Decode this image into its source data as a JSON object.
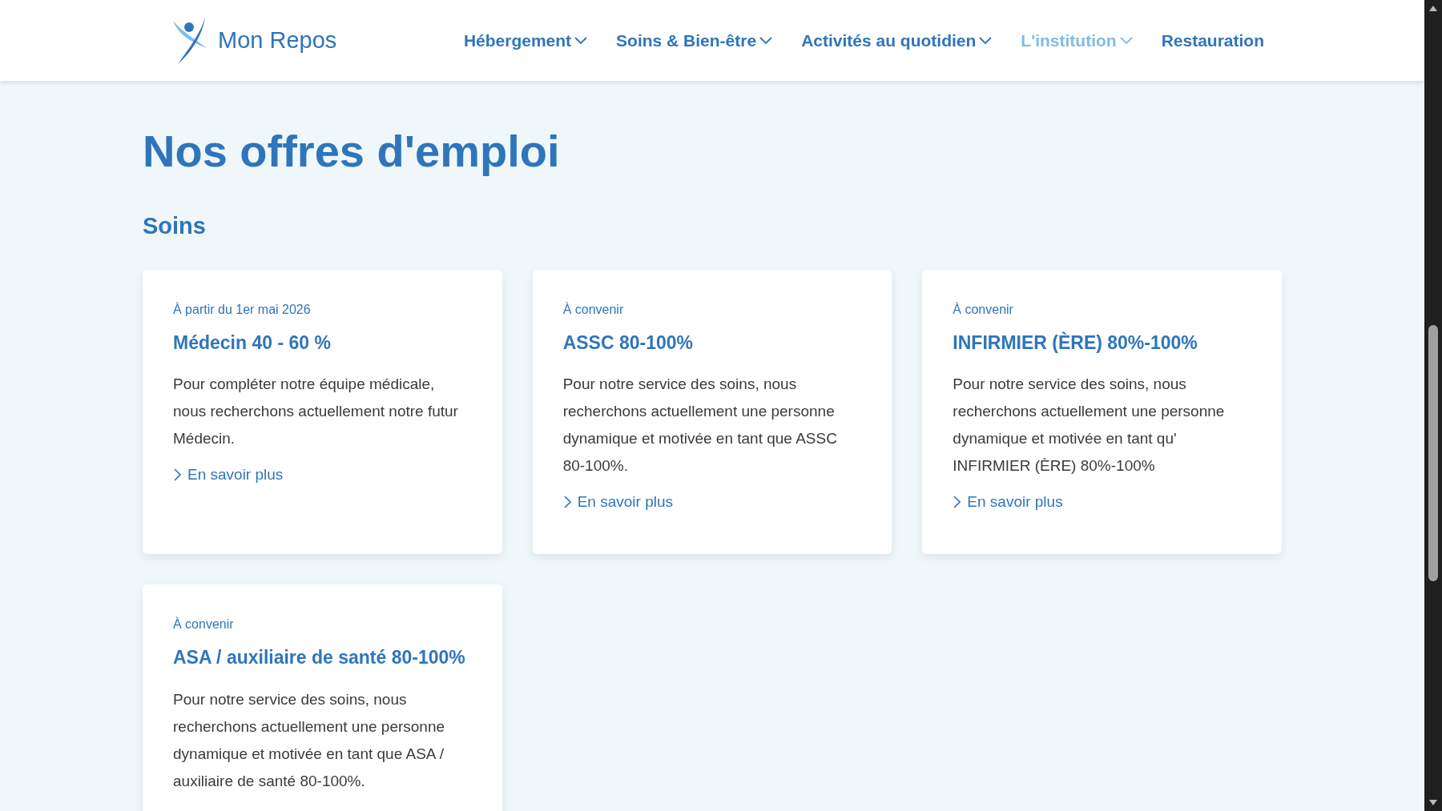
{
  "header": {
    "logo_text": "Mon Repos",
    "nav": [
      {
        "label": "Hébergement",
        "has_dropdown": true,
        "selected": false
      },
      {
        "label": "Soins & Bien-être",
        "has_dropdown": true,
        "selected": false
      },
      {
        "label": "Activités au quotidien",
        "has_dropdown": true,
        "selected": false
      },
      {
        "label": "L'institution",
        "has_dropdown": true,
        "selected": true
      },
      {
        "label": "Restauration",
        "has_dropdown": false,
        "selected": false
      }
    ]
  },
  "page_title": "Nos offres d'emploi",
  "section_title": "Soins",
  "jobs": [
    {
      "date": "À partir du 1er mai 2026",
      "title": "Médecin 40 - 60 %",
      "description": "Pour compléter notre équipe médicale, nous recherchons actuellement notre futur Médecin.",
      "link": "En savoir plus"
    },
    {
      "date": "À convenir",
      "title": "ASSC 80-100%",
      "description": "Pour notre service des soins, nous recherchons actuellement une personne dynamique et motivée en tant que ASSC 80-100%.",
      "link": "En savoir plus"
    },
    {
      "date": "À convenir",
      "title": "INFIRMIER (ÈRE) 80%-100%",
      "description": "Pour notre service des soins, nous recherchons actuellement une personne dynamique et motivée en tant qu' INFIRMIER (ÈRE) 80%-100%",
      "link": "En savoir plus"
    },
    {
      "date": "À convenir",
      "title": "ASA / auxiliaire de santé 80-100%",
      "description": "Pour notre service des soins, nous recherchons actuellement une personne dynamique et motivée en tant que ASA / auxiliaire de santé 80-100%."
    }
  ]
}
